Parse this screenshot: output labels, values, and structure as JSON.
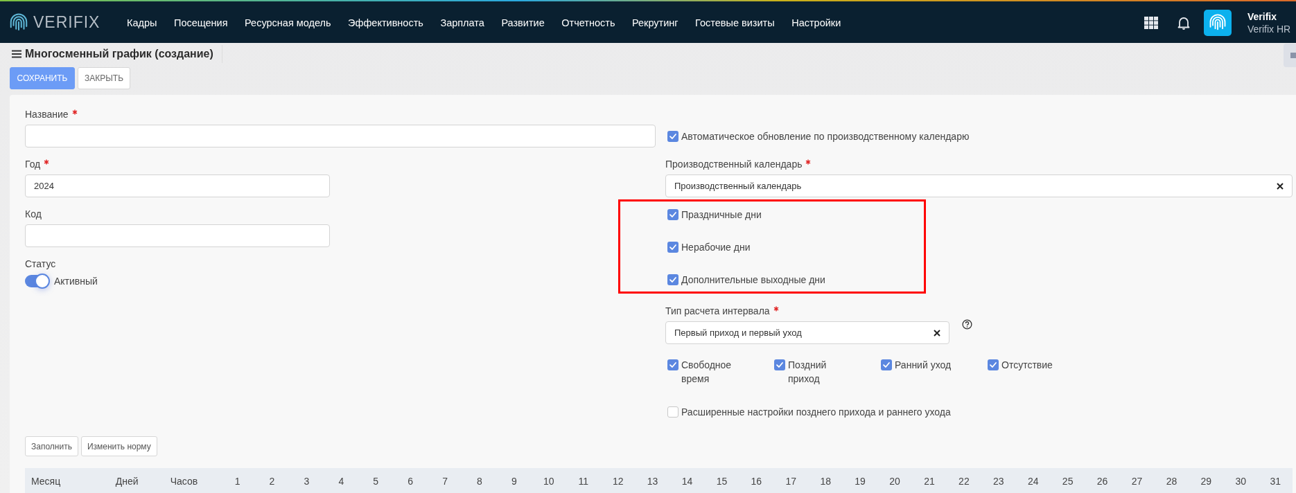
{
  "topbar": {
    "logo_text": "VERIFIX",
    "nav": [
      {
        "label": "Кадры"
      },
      {
        "label": "Посещения"
      },
      {
        "label": "Ресурсная модель"
      },
      {
        "label": "Эффективность"
      },
      {
        "label": "Зарплата"
      },
      {
        "label": "Развитие"
      },
      {
        "label": "Отчетность"
      },
      {
        "label": "Рекрутинг"
      },
      {
        "label": "Гостевые визиты"
      },
      {
        "label": "Настройки"
      }
    ],
    "user": {
      "name": "Verifix",
      "org": "Verifix HR"
    }
  },
  "page": {
    "title": "Многосменный график (создание)",
    "actions": [
      {
        "label": "СОХРАНИТЬ",
        "kind": "primary"
      },
      {
        "label": "ЗАКРЫТЬ",
        "kind": "default"
      }
    ]
  },
  "form": {
    "name": {
      "label": "Название",
      "required": true
    },
    "year": {
      "label": "Год",
      "required": true,
      "value": "2024"
    },
    "code": {
      "label": "Код",
      "required": false
    },
    "status": {
      "label": "Статус",
      "on": true,
      "text": "Активный"
    },
    "auto_update": {
      "label": "Автоматическое обновление по производственному календарю",
      "checked": true
    },
    "calendar": {
      "label": "Производственный календарь",
      "required": true,
      "value": "Производственный календарь"
    },
    "calendar_days": {
      "highlighted": true,
      "items": [
        {
          "label": "Праздничные дни",
          "checked": true
        },
        {
          "label": "Нерабочие дни",
          "checked": true
        },
        {
          "label": "Дополнительные выходные дни",
          "checked": true
        }
      ]
    },
    "interval_type": {
      "label": "Тип расчета интервала",
      "required": true,
      "value": "Первый приход и первый уход"
    },
    "violations": [
      {
        "label": "Свободное время",
        "checked": true
      },
      {
        "label": "Поздний приход",
        "checked": true
      },
      {
        "label": "Ранний уход",
        "checked": true
      },
      {
        "label": "Отсутствие",
        "checked": true
      }
    ],
    "advanced": {
      "label": "Расширенные настройки позднего прихода и раннего ухода",
      "checked": false
    }
  },
  "table_actions": [
    {
      "label": "Заполнить"
    },
    {
      "label": "Изменить норму"
    }
  ],
  "table": {
    "columns": [
      "Месяц",
      "Дней",
      "Часов"
    ],
    "days": [
      "1",
      "2",
      "3",
      "4",
      "5",
      "6",
      "7",
      "8",
      "9",
      "10",
      "11",
      "12",
      "13",
      "14",
      "15",
      "16",
      "17",
      "18",
      "19",
      "20",
      "21",
      "22",
      "23",
      "24",
      "25",
      "26",
      "27",
      "28",
      "29",
      "30",
      "31"
    ]
  }
}
